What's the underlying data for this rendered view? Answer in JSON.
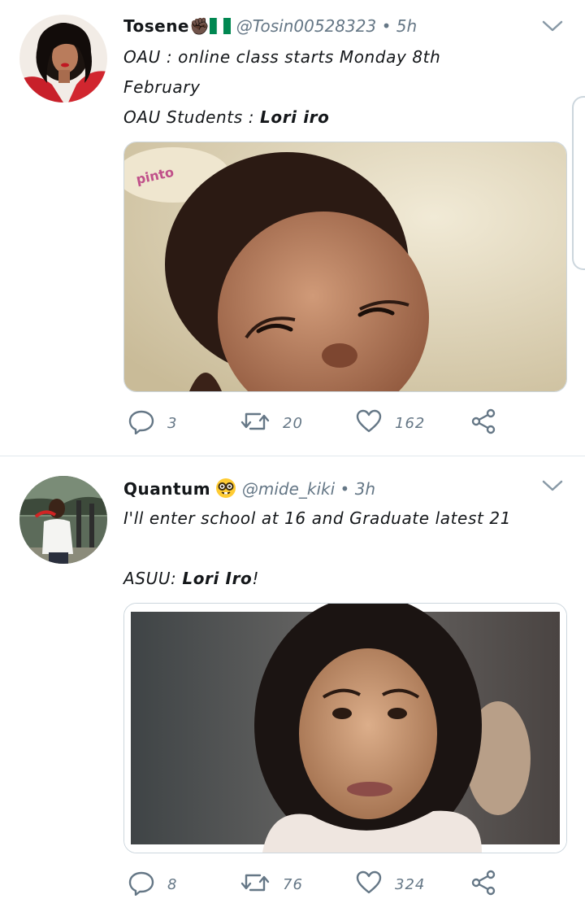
{
  "tweets": [
    {
      "name": "Tosene✊🏿",
      "handle": "@Tosin00528323",
      "separator": "•",
      "time": "5h",
      "body": {
        "line1": "OAU : online class starts Monday 8th",
        "line2": "February",
        "line3_prefix": "OAU Students : ",
        "line3_bold": "Lori iro"
      },
      "media_text": "pinto",
      "replies": "3",
      "retweets": "20",
      "likes": "162"
    },
    {
      "name": "Quantum",
      "handle": "@mide_kiki",
      "separator": "•",
      "time": "3h",
      "body": {
        "line1": "I'll enter school at 16 and Graduate latest 21",
        "line2_prefix": "ASUU: ",
        "line2_bold": "Lori Iro",
        "line2_suffix": "!"
      },
      "replies": "8",
      "retweets": "76",
      "likes": "324"
    }
  ],
  "icons": {
    "reply": "reply-icon",
    "retweet": "retweet-icon",
    "like": "heart-icon",
    "share": "share-icon",
    "more": "chevron-down-icon"
  },
  "colors": {
    "text": "#14171a",
    "secondary": "#657786",
    "border": "#e1e8ed",
    "flag_green": "#008751"
  }
}
